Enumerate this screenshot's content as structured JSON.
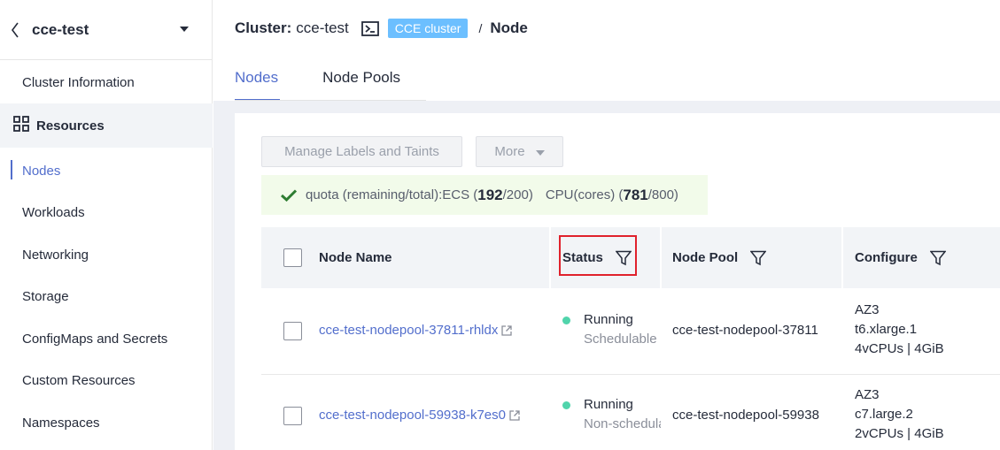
{
  "sidebar": {
    "cluster_name": "cce-test",
    "items_top": [
      "Cluster Information"
    ],
    "section_label": "Resources",
    "items": [
      "Nodes",
      "Workloads",
      "Networking",
      "Storage",
      "ConfigMaps and Secrets",
      "Custom Resources",
      "Namespaces"
    ],
    "active_item": "Nodes"
  },
  "header": {
    "cluster_label": "Cluster:",
    "cluster_name": "cce-test",
    "badge": "CCE cluster",
    "separator": "/",
    "page": "Node"
  },
  "tabs": [
    "Nodes",
    "Node Pools"
  ],
  "active_tab": "Nodes",
  "toolbar": {
    "manage_labels": "Manage Labels and Taints",
    "more": "More"
  },
  "quota": {
    "prefix": "quota (remaining/total):ECS (",
    "ecs_remaining": "192",
    "ecs_total_suffix": "/200)",
    "cpu_prefix": "CPU(cores) (",
    "cpu_remaining": "781",
    "cpu_total_suffix": "/800)"
  },
  "table": {
    "columns": [
      "Node Name",
      "Status",
      "Node Pool",
      "Configure"
    ],
    "rows": [
      {
        "name": "cce-test-nodepool-37811-rhldx",
        "status": "Running",
        "sub_status": "Schedulable",
        "pool": "cce-test-nodepool-37811",
        "config": [
          "AZ3",
          "t6.xlarge.1",
          "4vCPUs | 4GiB"
        ]
      },
      {
        "name": "cce-test-nodepool-59938-k7es0",
        "status": "Running",
        "sub_status": "Non-schedula",
        "pool": "cce-test-nodepool-59938",
        "config": [
          "AZ3",
          "c7.large.2",
          "2vCPUs | 4GiB"
        ]
      }
    ]
  },
  "colors": {
    "accent": "#526ecc",
    "badge": "#6cbfff",
    "running_dot": "#50d4ab",
    "highlight": "#e0212c"
  }
}
